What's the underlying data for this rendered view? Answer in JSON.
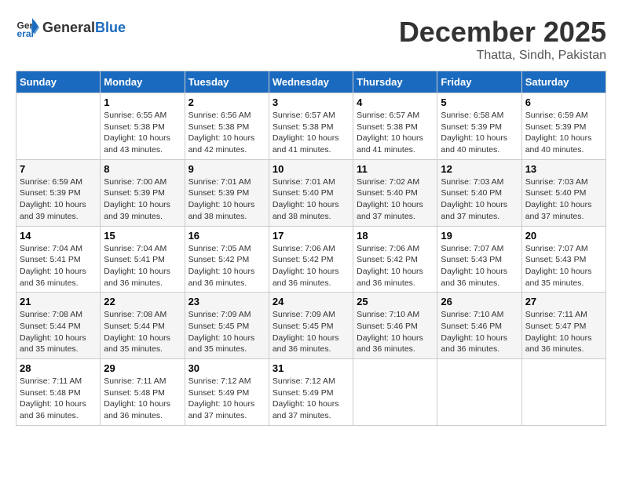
{
  "header": {
    "logo_general": "General",
    "logo_blue": "Blue",
    "month": "December 2025",
    "location": "Thatta, Sindh, Pakistan"
  },
  "days_of_week": [
    "Sunday",
    "Monday",
    "Tuesday",
    "Wednesday",
    "Thursday",
    "Friday",
    "Saturday"
  ],
  "weeks": [
    [
      {
        "day": "",
        "info": ""
      },
      {
        "day": "1",
        "info": "Sunrise: 6:55 AM\nSunset: 5:38 PM\nDaylight: 10 hours\nand 43 minutes."
      },
      {
        "day": "2",
        "info": "Sunrise: 6:56 AM\nSunset: 5:38 PM\nDaylight: 10 hours\nand 42 minutes."
      },
      {
        "day": "3",
        "info": "Sunrise: 6:57 AM\nSunset: 5:38 PM\nDaylight: 10 hours\nand 41 minutes."
      },
      {
        "day": "4",
        "info": "Sunrise: 6:57 AM\nSunset: 5:38 PM\nDaylight: 10 hours\nand 41 minutes."
      },
      {
        "day": "5",
        "info": "Sunrise: 6:58 AM\nSunset: 5:39 PM\nDaylight: 10 hours\nand 40 minutes."
      },
      {
        "day": "6",
        "info": "Sunrise: 6:59 AM\nSunset: 5:39 PM\nDaylight: 10 hours\nand 40 minutes."
      }
    ],
    [
      {
        "day": "7",
        "info": "Sunrise: 6:59 AM\nSunset: 5:39 PM\nDaylight: 10 hours\nand 39 minutes."
      },
      {
        "day": "8",
        "info": "Sunrise: 7:00 AM\nSunset: 5:39 PM\nDaylight: 10 hours\nand 39 minutes."
      },
      {
        "day": "9",
        "info": "Sunrise: 7:01 AM\nSunset: 5:39 PM\nDaylight: 10 hours\nand 38 minutes."
      },
      {
        "day": "10",
        "info": "Sunrise: 7:01 AM\nSunset: 5:40 PM\nDaylight: 10 hours\nand 38 minutes."
      },
      {
        "day": "11",
        "info": "Sunrise: 7:02 AM\nSunset: 5:40 PM\nDaylight: 10 hours\nand 37 minutes."
      },
      {
        "day": "12",
        "info": "Sunrise: 7:03 AM\nSunset: 5:40 PM\nDaylight: 10 hours\nand 37 minutes."
      },
      {
        "day": "13",
        "info": "Sunrise: 7:03 AM\nSunset: 5:40 PM\nDaylight: 10 hours\nand 37 minutes."
      }
    ],
    [
      {
        "day": "14",
        "info": "Sunrise: 7:04 AM\nSunset: 5:41 PM\nDaylight: 10 hours\nand 36 minutes."
      },
      {
        "day": "15",
        "info": "Sunrise: 7:04 AM\nSunset: 5:41 PM\nDaylight: 10 hours\nand 36 minutes."
      },
      {
        "day": "16",
        "info": "Sunrise: 7:05 AM\nSunset: 5:42 PM\nDaylight: 10 hours\nand 36 minutes."
      },
      {
        "day": "17",
        "info": "Sunrise: 7:06 AM\nSunset: 5:42 PM\nDaylight: 10 hours\nand 36 minutes."
      },
      {
        "day": "18",
        "info": "Sunrise: 7:06 AM\nSunset: 5:42 PM\nDaylight: 10 hours\nand 36 minutes."
      },
      {
        "day": "19",
        "info": "Sunrise: 7:07 AM\nSunset: 5:43 PM\nDaylight: 10 hours\nand 36 minutes."
      },
      {
        "day": "20",
        "info": "Sunrise: 7:07 AM\nSunset: 5:43 PM\nDaylight: 10 hours\nand 35 minutes."
      }
    ],
    [
      {
        "day": "21",
        "info": "Sunrise: 7:08 AM\nSunset: 5:44 PM\nDaylight: 10 hours\nand 35 minutes."
      },
      {
        "day": "22",
        "info": "Sunrise: 7:08 AM\nSunset: 5:44 PM\nDaylight: 10 hours\nand 35 minutes."
      },
      {
        "day": "23",
        "info": "Sunrise: 7:09 AM\nSunset: 5:45 PM\nDaylight: 10 hours\nand 35 minutes."
      },
      {
        "day": "24",
        "info": "Sunrise: 7:09 AM\nSunset: 5:45 PM\nDaylight: 10 hours\nand 36 minutes."
      },
      {
        "day": "25",
        "info": "Sunrise: 7:10 AM\nSunset: 5:46 PM\nDaylight: 10 hours\nand 36 minutes."
      },
      {
        "day": "26",
        "info": "Sunrise: 7:10 AM\nSunset: 5:46 PM\nDaylight: 10 hours\nand 36 minutes."
      },
      {
        "day": "27",
        "info": "Sunrise: 7:11 AM\nSunset: 5:47 PM\nDaylight: 10 hours\nand 36 minutes."
      }
    ],
    [
      {
        "day": "28",
        "info": "Sunrise: 7:11 AM\nSunset: 5:48 PM\nDaylight: 10 hours\nand 36 minutes."
      },
      {
        "day": "29",
        "info": "Sunrise: 7:11 AM\nSunset: 5:48 PM\nDaylight: 10 hours\nand 36 minutes."
      },
      {
        "day": "30",
        "info": "Sunrise: 7:12 AM\nSunset: 5:49 PM\nDaylight: 10 hours\nand 37 minutes."
      },
      {
        "day": "31",
        "info": "Sunrise: 7:12 AM\nSunset: 5:49 PM\nDaylight: 10 hours\nand 37 minutes."
      },
      {
        "day": "",
        "info": ""
      },
      {
        "day": "",
        "info": ""
      },
      {
        "day": "",
        "info": ""
      }
    ]
  ]
}
